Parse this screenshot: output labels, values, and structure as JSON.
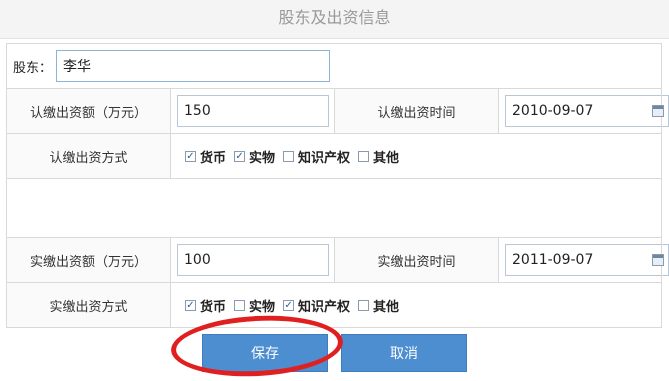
{
  "page": {
    "title": "股东及出资信息"
  },
  "shareholder": {
    "label": "股东：",
    "value": "李华"
  },
  "subscribed": {
    "amount_label": "认缴出资额（万元）",
    "amount_value": "150",
    "time_label": "认缴出资时间",
    "time_value": "2010-09-07",
    "method_label": "认缴出资方式",
    "methods": [
      {
        "label": "货币",
        "checked": true
      },
      {
        "label": "实物",
        "checked": true
      },
      {
        "label": "知识产权",
        "checked": false
      },
      {
        "label": "其他",
        "checked": false
      }
    ]
  },
  "paid": {
    "amount_label": "实缴出资额（万元）",
    "amount_value": "100",
    "time_label": "实缴出资时间",
    "time_value": "2011-09-07",
    "method_label": "实缴出资方式",
    "methods": [
      {
        "label": "货币",
        "checked": true
      },
      {
        "label": "实物",
        "checked": false
      },
      {
        "label": "知识产权",
        "checked": true
      },
      {
        "label": "其他",
        "checked": false
      }
    ]
  },
  "buttons": {
    "save": "保存",
    "cancel": "取消"
  },
  "colors": {
    "button": "#4d8ed1",
    "annotation": "#e02020"
  },
  "icons": {
    "date_picker": "calendar-icon"
  }
}
